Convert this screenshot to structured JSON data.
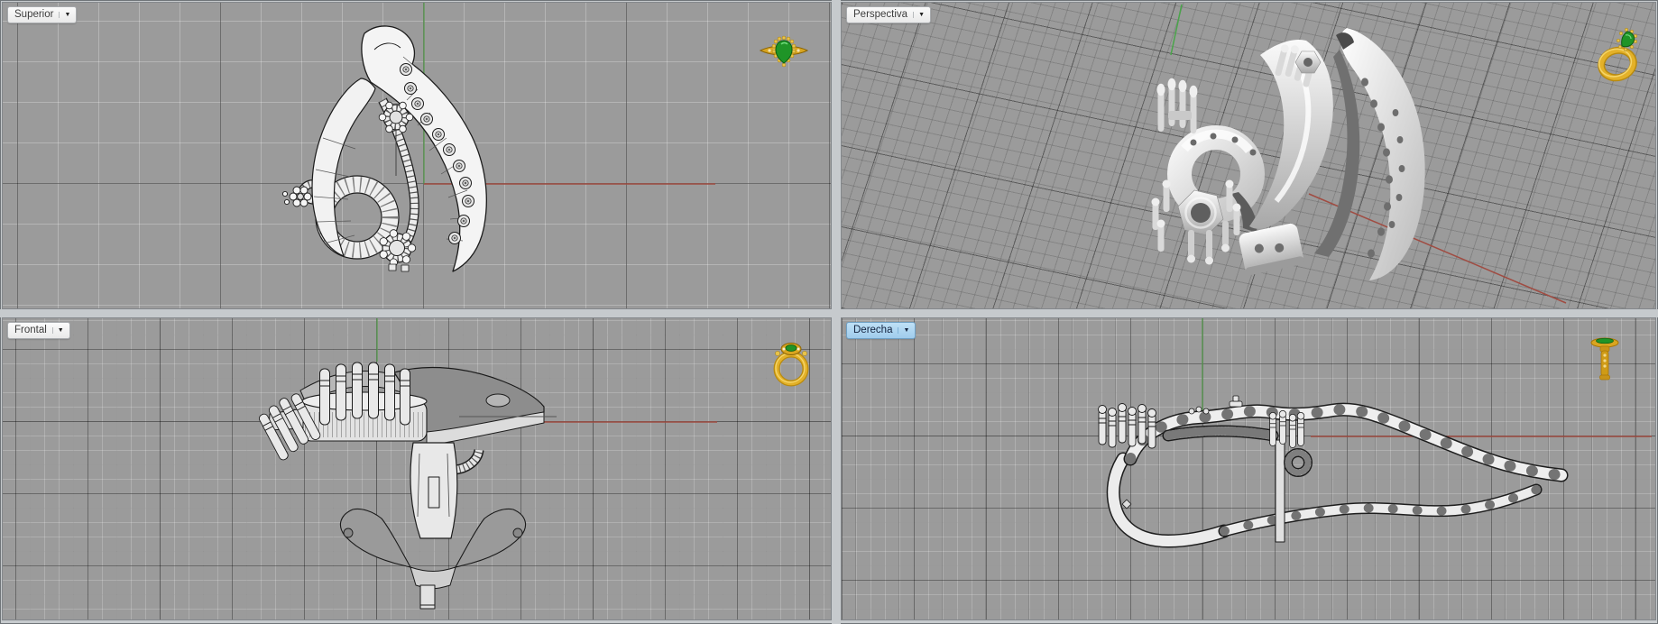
{
  "viewports": [
    {
      "id": "superior",
      "label": "Superior",
      "active": false,
      "projection": "parallel-top"
    },
    {
      "id": "perspectiva",
      "label": "Perspectiva",
      "active": false,
      "projection": "perspective"
    },
    {
      "id": "frontal",
      "label": "Frontal",
      "active": false,
      "projection": "parallel-front"
    },
    {
      "id": "derecha",
      "label": "Derecha",
      "active": true,
      "projection": "parallel-right"
    }
  ],
  "ui": {
    "dropdown_glyph": "▼"
  },
  "icons": {
    "superior": "ring-preview-top-icon",
    "perspectiva": "ring-preview-perspective-icon",
    "frontal": "ring-preview-front-icon",
    "derecha": "ring-preview-side-icon"
  },
  "colors": {
    "viewport_background": "#9b9b9b",
    "frame": "#c6cacd",
    "grid_minor": "#a9a9a9",
    "grid_major": "#5f5f5f",
    "axis_x": "#a04c42",
    "axis_y": "#5d9b55",
    "tab_background": "#f2f2f2",
    "tab_active_background": "#a6d2f0",
    "tab_text": "#3c3c3c",
    "model_surface": "#f0f0f0",
    "model_outline": "#1c1c1c",
    "ring_gold": "#d9a520",
    "gem_green": "#1f9427"
  }
}
